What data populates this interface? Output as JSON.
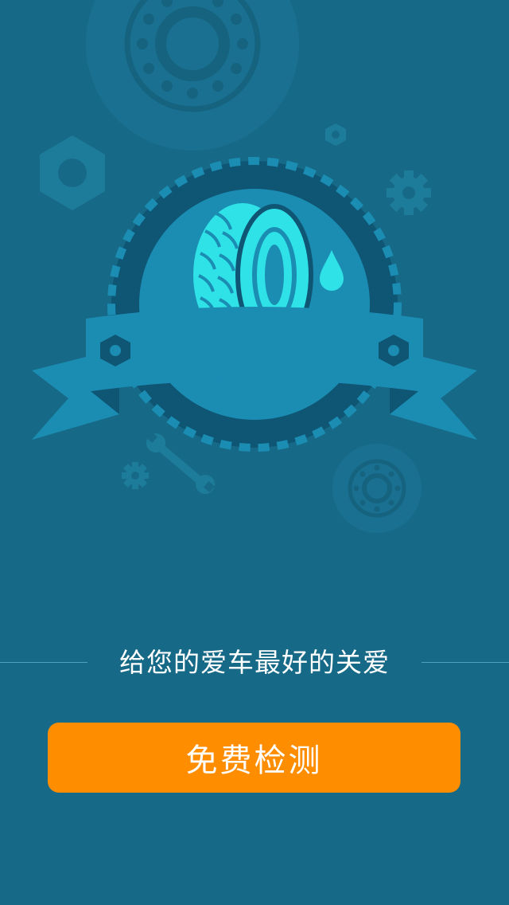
{
  "tagline": "给您的爱车最好的关爱",
  "cta": {
    "label": "免费检测"
  },
  "icons": {
    "illustration": "car-care-badge-illustration",
    "tire": "tire-icon",
    "water_drop": "water-drop-icon",
    "wrench": "wrench-icon",
    "gear": "gear-icon",
    "bearing": "bearing-icon",
    "hex_nut": "hex-nut-icon"
  },
  "colors": {
    "background": "#176a87",
    "button": "#ff8d00",
    "button_text": "#ffffff",
    "tagline_text": "#ffffff",
    "divider": "#4fa2bd",
    "tire": "#2ee2e7",
    "badge_dark": "#0f5675",
    "ribbon": "#1b8db3"
  }
}
